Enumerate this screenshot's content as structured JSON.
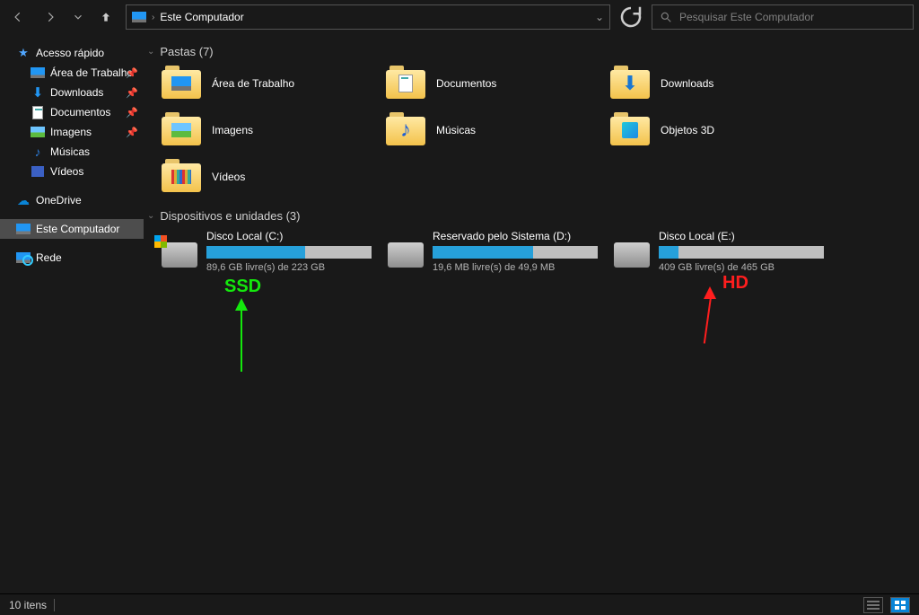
{
  "address": {
    "location": "Este Computador"
  },
  "search": {
    "placeholder": "Pesquisar Este Computador"
  },
  "sidebar": {
    "quick_access": "Acesso rápido",
    "pinned": [
      {
        "label": "Área de Trabalho"
      },
      {
        "label": "Downloads"
      },
      {
        "label": "Documentos"
      },
      {
        "label": "Imagens"
      },
      {
        "label": "Músicas"
      },
      {
        "label": "Vídeos"
      }
    ],
    "onedrive": "OneDrive",
    "this_pc": "Este Computador",
    "network": "Rede"
  },
  "sections": {
    "folders_title": "Pastas (7)",
    "drives_title": "Dispositivos e unidades (3)"
  },
  "folders": [
    {
      "label": "Área de Trabalho"
    },
    {
      "label": "Documentos"
    },
    {
      "label": "Downloads"
    },
    {
      "label": "Imagens"
    },
    {
      "label": "Músicas"
    },
    {
      "label": "Objetos 3D"
    },
    {
      "label": "Vídeos"
    }
  ],
  "drives": [
    {
      "name": "Disco Local (C:)",
      "free": "89,6 GB livre(s) de 223 GB",
      "used_pct": 60
    },
    {
      "name": "Reservado pelo Sistema (D:)",
      "free": "19,6 MB livre(s) de 49,9 MB",
      "used_pct": 61
    },
    {
      "name": "Disco Local (E:)",
      "free": "409 GB livre(s) de 465 GB",
      "used_pct": 12
    }
  ],
  "annotations": {
    "ssd": "SSD",
    "hd": "HD"
  },
  "status": {
    "items": "10 itens"
  }
}
